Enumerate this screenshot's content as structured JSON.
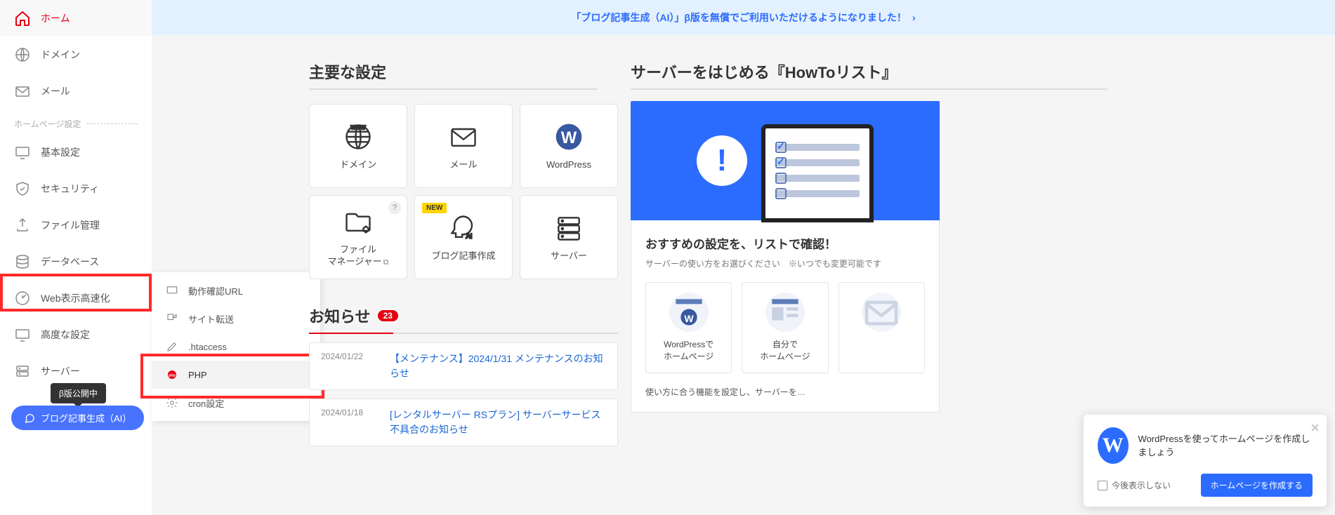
{
  "banner": "「ブログ記事生成（AI）」β版を無償でご利用いただけるようになりました！",
  "sidebar": {
    "items": [
      {
        "label": "ホーム"
      },
      {
        "label": "ドメイン"
      },
      {
        "label": "メール"
      }
    ],
    "section": "ホームページ設定",
    "hp_items": [
      {
        "label": "基本設定"
      },
      {
        "label": "セキュリティ"
      },
      {
        "label": "ファイル管理"
      },
      {
        "label": "データベース"
      },
      {
        "label": "Web表示高速化"
      },
      {
        "label": "高度な設定"
      },
      {
        "label": "サーバー"
      }
    ],
    "beta_tip": "β版公開中",
    "beta_btn": "ブログ記事生成（AI）"
  },
  "flyout": {
    "items": [
      {
        "label": "動作確認URL"
      },
      {
        "label": "サイト転送"
      },
      {
        "label": ".htaccess"
      },
      {
        "label": "PHP"
      },
      {
        "label": "cron設定"
      }
    ]
  },
  "main": {
    "head1": "主要な設定",
    "tiles": [
      {
        "label": "ドメイン"
      },
      {
        "label": "メール"
      },
      {
        "label": "WordPress"
      },
      {
        "label": "ファイル\nマネージャー",
        "ext": true,
        "q": true
      },
      {
        "label": "ブログ記事作成",
        "new": "NEW"
      },
      {
        "label": "サーバー"
      }
    ],
    "notice_head": "お知らせ",
    "notice_count": "23",
    "notices": [
      {
        "date": "2024/01/22",
        "title": "【メンテナンス】2024/1/31 メンテナンスのお知らせ"
      },
      {
        "date": "2024/01/18",
        "title": "[レンタルサーバー RSプラン] サーバーサービス不具合のお知らせ"
      }
    ]
  },
  "howto": {
    "head": "サーバーをはじめる『HowToリスト』",
    "h3": "おすすめの設定を、リストで確認！",
    "p": "サーバーの使い方をお選びください　※いつでも変更可能です",
    "opts": [
      {
        "label": "WordPressで\nホームページ"
      },
      {
        "label": "自分で\nホームページ"
      },
      {
        "label": ""
      }
    ],
    "foot": "使い方に合う機能を設定し、サーバーを…"
  },
  "popup": {
    "text": "WordPressを使ってホームページを作成しましょう",
    "chk": "今後表示しない",
    "btn": "ホームページを作成する"
  }
}
